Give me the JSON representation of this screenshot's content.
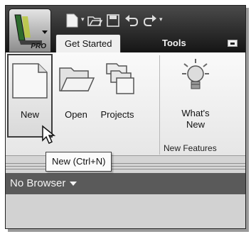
{
  "app": {
    "badge": "PRO"
  },
  "quick_access_toolbar": {
    "icons": [
      "new-document-icon",
      "open-folder-icon",
      "save-icon",
      "undo-icon",
      "redo-icon",
      "customize-dropdown-icon"
    ]
  },
  "tabs": [
    {
      "label": "Get Started",
      "active": true
    },
    {
      "label": "Tools",
      "active": false
    }
  ],
  "ribbon": {
    "buttons": [
      {
        "label": "New",
        "icon": "new-document-icon"
      },
      {
        "label": "Open",
        "icon": "open-folder-icon"
      },
      {
        "label": "Projects",
        "icon": "projects-icon"
      },
      {
        "label": "What's New",
        "icon": "lightbulb-icon"
      }
    ],
    "panels": [
      {
        "label": "New Features"
      }
    ]
  },
  "tooltip": {
    "text": "New (Ctrl+N)"
  },
  "browser": {
    "title": "No Browser"
  },
  "colors": {
    "title_bar": "#2a2a2a",
    "browser_bar": "#5a5a5a",
    "ribbon": "#efefef"
  }
}
